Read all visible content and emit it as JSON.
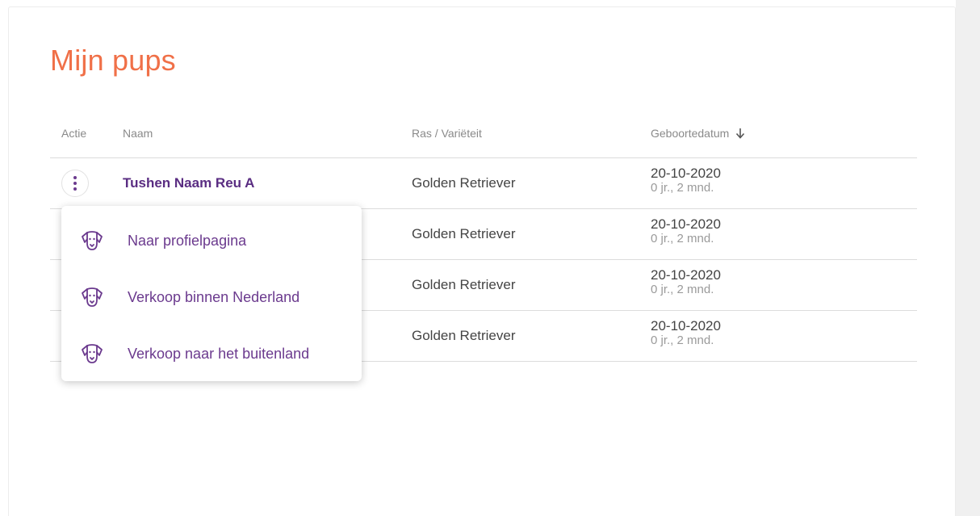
{
  "page": {
    "title": "Mijn pups"
  },
  "table": {
    "headers": {
      "actie": "Actie",
      "naam": "Naam",
      "ras": "Ras / Variëteit",
      "geboortedatum": "Geboortedatum"
    },
    "sort_icon": "arrow-down-icon",
    "rows": [
      {
        "naam": "Tushen Naam Reu A",
        "ras": "Golden Retriever",
        "datum": "20-10-2020",
        "leeftijd": "0 jr., 2 mnd."
      },
      {
        "naam": "",
        "ras": "Golden Retriever",
        "datum": "20-10-2020",
        "leeftijd": "0 jr., 2 mnd."
      },
      {
        "naam": "",
        "ras": "Golden Retriever",
        "datum": "20-10-2020",
        "leeftijd": "0 jr., 2 mnd."
      },
      {
        "naam": "",
        "ras": "Golden Retriever",
        "datum": "20-10-2020",
        "leeftijd": "0 jr., 2 mnd."
      }
    ]
  },
  "action_menu": {
    "items": [
      {
        "label": "Naar profielpagina",
        "icon": "dog-icon"
      },
      {
        "label": "Verkoop binnen Nederland",
        "icon": "dog-icon"
      },
      {
        "label": "Verkoop naar het buitenland",
        "icon": "dog-icon"
      }
    ]
  },
  "colors": {
    "title": "#f07048",
    "accent": "#6b3a8e",
    "name": "#5a2d82",
    "muted": "#9a9a9a"
  }
}
